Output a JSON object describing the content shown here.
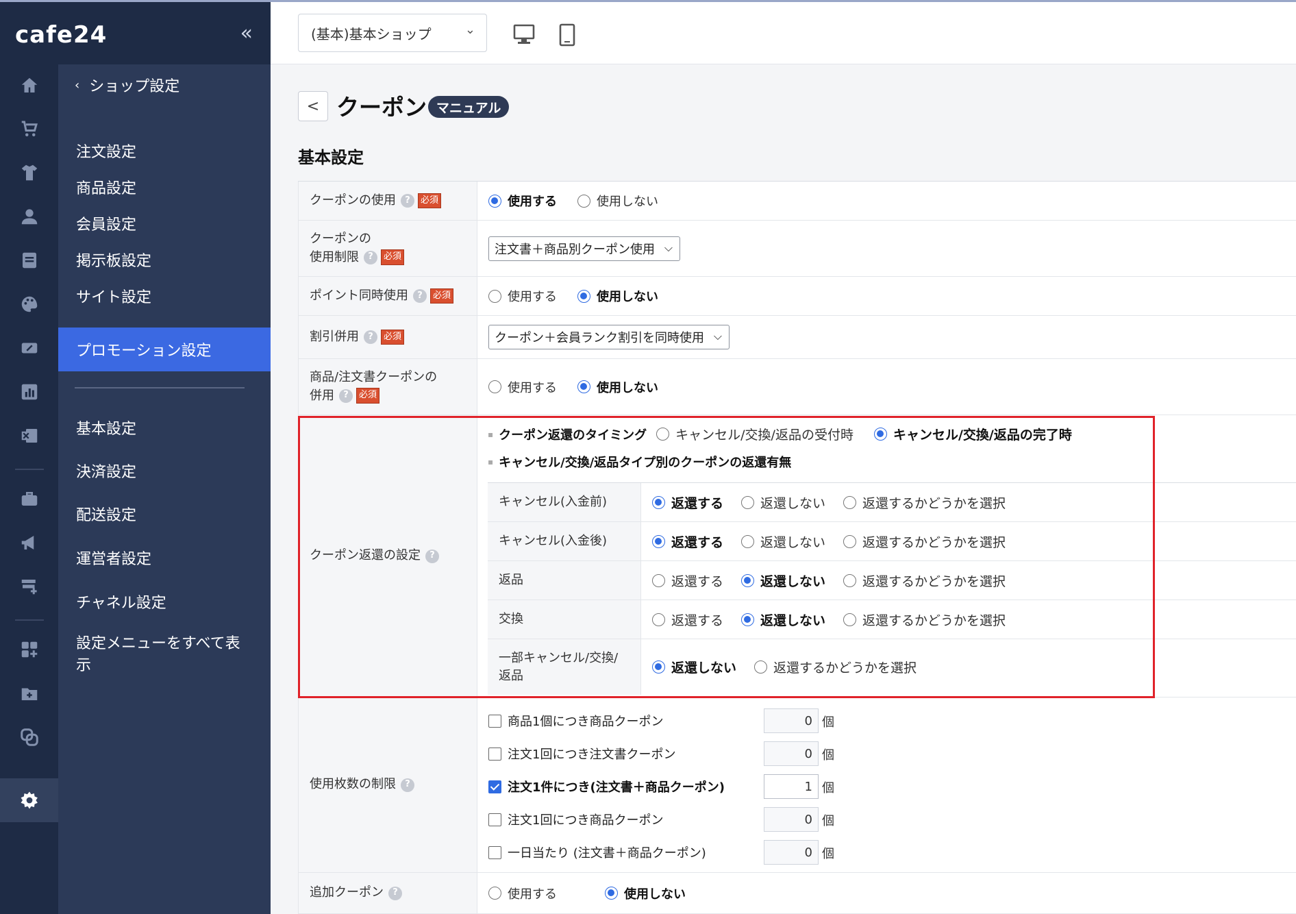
{
  "sidebar": {
    "logo": "cafe24",
    "collapse_label": "«",
    "rail_icons": [
      "home-icon",
      "cart-icon",
      "shirt-icon",
      "person-icon",
      "board-icon",
      "palette-icon",
      "ticket-icon",
      "chart-icon",
      "excel-icon",
      "toolbox-icon",
      "megaphone-icon",
      "store-add-icon",
      "widgets-add-icon",
      "folder-add-icon",
      "link-icon",
      "gear-icon"
    ],
    "back_label": "ショップ設定",
    "items_top": [
      "注文設定",
      "商品設定",
      "会員設定",
      "掲示板設定",
      "サイト設定",
      "プロモーション設定"
    ],
    "items_bottom": [
      "基本設定",
      "決済設定",
      "配送設定",
      "運営者設定",
      "チャネル設定",
      "設定メニューをすべて表示"
    ],
    "active_item": "プロモーション設定"
  },
  "topbar": {
    "shop_select": "(基本)基本ショップ"
  },
  "page": {
    "back": "<",
    "title": "クーポン",
    "manual_badge": "マニュアル",
    "section_title": "基本設定"
  },
  "form": {
    "required_label": "必須",
    "help_label": "?",
    "coupon_use": {
      "label": "クーポンの使用",
      "options": [
        "使用する",
        "使用しない"
      ],
      "selected": 0
    },
    "coupon_restriction": {
      "label_line1": "クーポンの",
      "label_line2": "使用制限",
      "value": "注文書＋商品別クーポン使用"
    },
    "point_combo": {
      "label": "ポイント同時使用",
      "options": [
        "使用する",
        "使用しない"
      ],
      "selected": 1
    },
    "discount_combo": {
      "label": "割引併用",
      "value": "クーポン＋会員ランク割引を同時使用"
    },
    "product_order_combo": {
      "label_line1": "商品/注文書クーポンの",
      "label_line2": "併用",
      "options": [
        "使用する",
        "使用しない"
      ],
      "selected": 1
    },
    "return_settings": {
      "label": "クーポン返還の設定",
      "timing_title": "クーポン返還のタイミング",
      "timing_options": [
        "キャンセル/交換/返品の受付時",
        "キャンセル/交換/返品の完了時"
      ],
      "timing_selected": 1,
      "type_title": "キャンセル/交換/返品タイプ別のクーポンの返還有無",
      "rows": [
        {
          "label": "キャンセル(入金前)",
          "options": [
            "返還する",
            "返還しない",
            "返還するかどうかを選択"
          ],
          "selected": 0
        },
        {
          "label": "キャンセル(入金後)",
          "options": [
            "返還する",
            "返還しない",
            "返還するかどうかを選択"
          ],
          "selected": 0
        },
        {
          "label": "返品",
          "options": [
            "返還する",
            "返還しない",
            "返還するかどうかを選択"
          ],
          "selected": 1
        },
        {
          "label": "交換",
          "options": [
            "返還する",
            "返還しない",
            "返還するかどうかを選択"
          ],
          "selected": 1
        },
        {
          "label_line1": "一部キャンセル/交換/",
          "label_line2": "返品",
          "options": [
            "返還しない",
            "返還するかどうかを選択"
          ],
          "selected": 0
        }
      ]
    },
    "usage_limit": {
      "label": "使用枚数の制限",
      "unit": "個",
      "items": [
        {
          "label": "商品1個につき商品クーポン",
          "checked": false,
          "value": "0"
        },
        {
          "label": "注文1回につき注文書クーポン",
          "checked": false,
          "value": "0"
        },
        {
          "label": "注文1件につき(注文書＋商品クーポン)",
          "checked": true,
          "value": "1"
        },
        {
          "label": "注文1回につき商品クーポン",
          "checked": false,
          "value": "0"
        },
        {
          "label": "一日当たり (注文書＋商品クーポン)",
          "checked": false,
          "value": "0"
        }
      ]
    },
    "additional_coupon": {
      "label": "追加クーポン",
      "options": [
        "使用する",
        "使用しない"
      ],
      "selected": 1
    }
  },
  "colors": {
    "sidebar_bg": "#1e2b45",
    "submenu_bg": "#2c3a58",
    "active_blue": "#3b69e2",
    "radio_blue": "#2f6be2",
    "highlight_red": "#e0222a",
    "required_red": "#d94f2f"
  }
}
